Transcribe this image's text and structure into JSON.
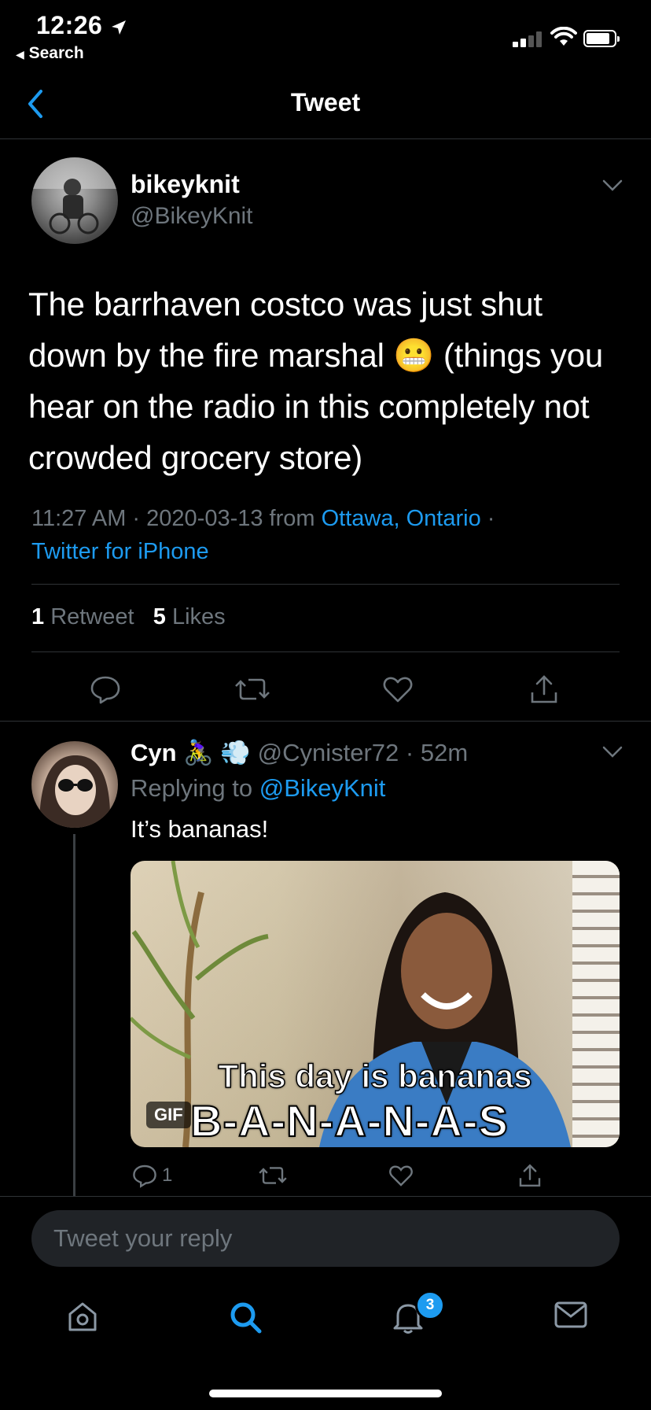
{
  "status_bar": {
    "time": "12:26",
    "back_label": "Search"
  },
  "header": {
    "title": "Tweet"
  },
  "tweet": {
    "display_name": "bikeyknit",
    "handle": "@BikeyKnit",
    "text_before_emoji": "The barrhaven costco was just shut down by the fire marshal ",
    "emoji": "😬",
    "text_after_emoji": " (things you hear on the radio in this completely not crowded grocery store)",
    "time_date": "11:27 AM · 2020-03-13 from ",
    "location": "Ottawa, Ontario",
    "separator": " ·",
    "source": "Twitter for iPhone",
    "retweet_count": "1",
    "retweet_label": "Retweet",
    "likes_count": "5",
    "likes_label": "Likes"
  },
  "reply": {
    "display_name": "Cyn",
    "name_emojis": "🚴‍♀️ 💨",
    "handle": "@Cynister72",
    "time": "· 52m",
    "replying_to_label": "Replying to ",
    "replying_to_handle": "@BikeyKnit",
    "text": "It’s bananas!",
    "gif": {
      "badge": "GIF",
      "caption_line1": "This day is bananas",
      "caption_line2": "B-A-N-A-N-A-S"
    },
    "reply_count": "1"
  },
  "reply_bar": {
    "placeholder": "Tweet your reply"
  },
  "tab_bar": {
    "notifications_badge": "3"
  },
  "colors": {
    "accent": "#1d9bf0",
    "background": "#000000",
    "secondary_text": "#6e767d",
    "divider": "#2f3336"
  },
  "icons": [
    "back-chevron-icon",
    "caret-down-icon",
    "reply-icon",
    "retweet-icon",
    "like-icon",
    "share-icon",
    "home-icon",
    "search-icon",
    "notifications-icon",
    "messages-icon"
  ]
}
